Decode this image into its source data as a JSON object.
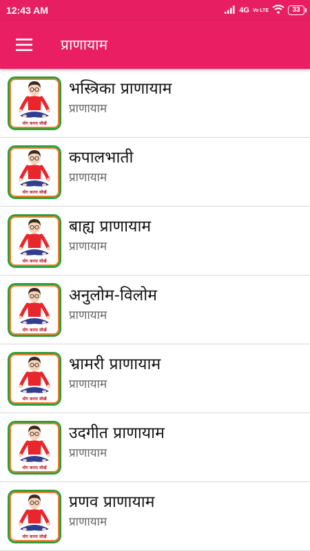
{
  "status_bar": {
    "time": "12:43 AM",
    "network": "4G",
    "volte": "Vo LTE",
    "battery": "33"
  },
  "app_bar": {
    "title": "प्राणायाम",
    "menu_icon": "hamburger-menu-icon"
  },
  "colors": {
    "primary": "#e91e63",
    "status_bar": "#e81e63",
    "divider": "#d8d8d8",
    "thumb_border_green": "#2e9e3a",
    "thumb_border_orange": "#f47c2c"
  },
  "list": {
    "items": [
      {
        "title": "भस्त्रिका प्राणायाम",
        "subtitle": "प्राणायाम",
        "thumb_caption": "योग करना सीखें"
      },
      {
        "title": "कपालभाती",
        "subtitle": "प्राणायाम",
        "thumb_caption": "योग करना सीखें"
      },
      {
        "title": "बाह्य प्राणायाम",
        "subtitle": "प्राणायाम",
        "thumb_caption": "योग करना सीखें"
      },
      {
        "title": "अनुलोम-विलोम",
        "subtitle": "प्राणायाम",
        "thumb_caption": "योग करना सीखें"
      },
      {
        "title": "भ्रामरी प्राणायाम",
        "subtitle": "प्राणायाम",
        "thumb_caption": "योग करना सीखें"
      },
      {
        "title": "उदगीत प्राणायाम",
        "subtitle": "प्राणायाम",
        "thumb_caption": "योग करना सीखें"
      },
      {
        "title": "प्रणव प्राणायाम",
        "subtitle": "प्राणायाम",
        "thumb_caption": "योग करना सीखें"
      }
    ]
  }
}
